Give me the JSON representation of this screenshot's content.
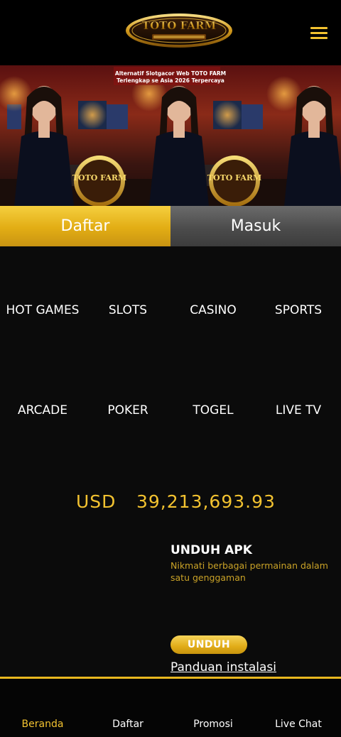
{
  "header": {
    "logo_text": "TOTO FARM",
    "menu_icon": "hamburger-menu-icon",
    "accent_color": "#f2c230"
  },
  "banner": {
    "caption_line1": "Alternatif Slotgacor Web TOTO FARM",
    "caption_line2": "Terlengkap se Asia  2026 Terpercaya",
    "logo_text": "TOTO FARM"
  },
  "auth": {
    "register_label": "Daftar",
    "login_label": "Masuk"
  },
  "games": [
    {
      "label": "HOT GAMES"
    },
    {
      "label": "SLOTS"
    },
    {
      "label": "CASINO"
    },
    {
      "label": "SPORTS"
    },
    {
      "label": "ARCADE"
    },
    {
      "label": "POKER"
    },
    {
      "label": "TOGEL"
    },
    {
      "label": "LIVE TV"
    }
  ],
  "jackpot": {
    "currency": "USD",
    "value": "39,213,693.93"
  },
  "apk": {
    "title": "UNDUH APK",
    "description": "Nikmati berbagai permainan dalam satu genggaman",
    "button_label": "UNDUH",
    "guide_link": "Panduan instalasi"
  },
  "bottom_nav": [
    {
      "label": "Beranda",
      "active": true
    },
    {
      "label": "Daftar",
      "active": false
    },
    {
      "label": "Promosi",
      "active": false
    },
    {
      "label": "Live Chat",
      "active": false
    }
  ]
}
